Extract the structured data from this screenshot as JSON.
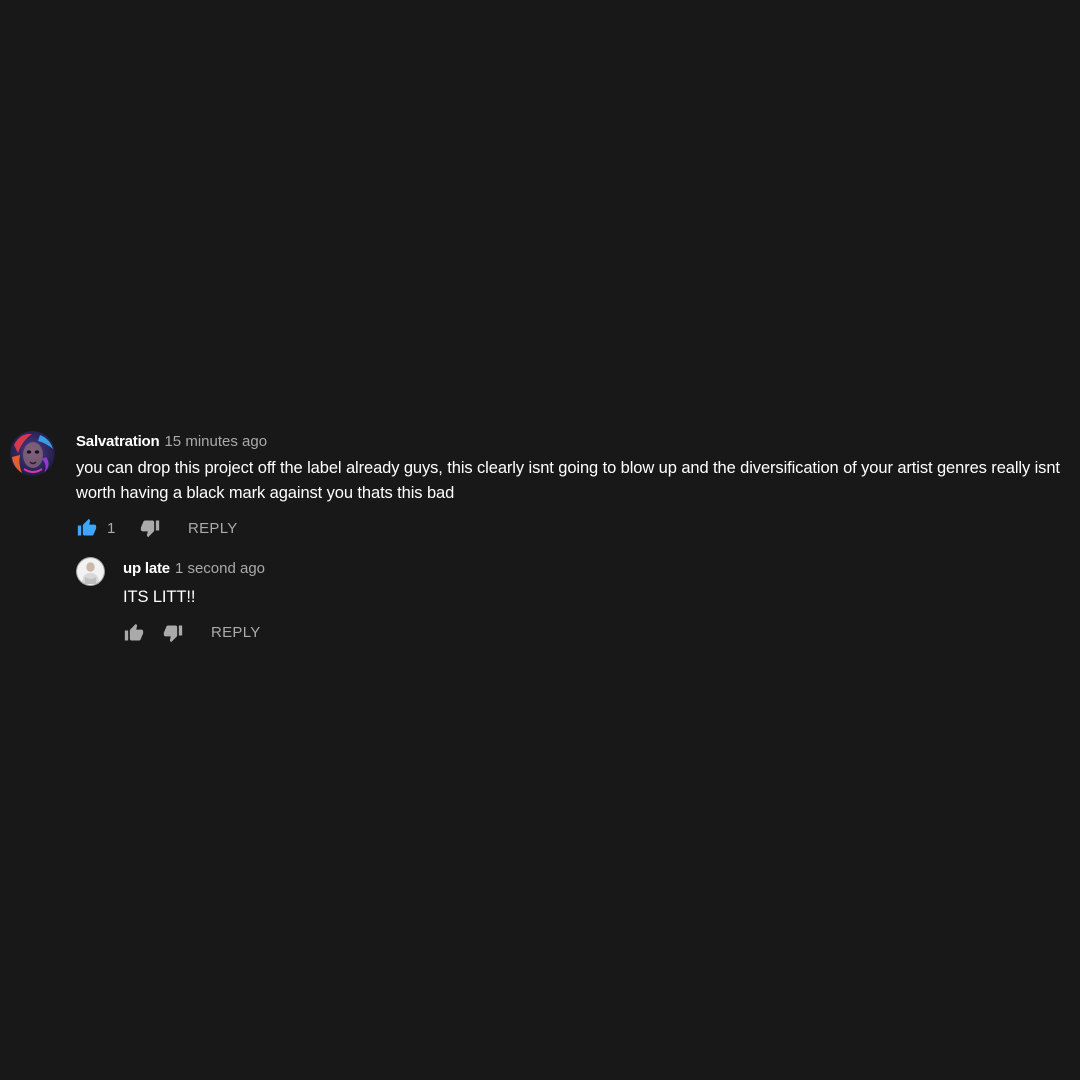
{
  "comment": {
    "author": "Salvatration",
    "time": "15 minutes ago",
    "text": "you can drop this project off the label already guys, this clearly isnt going to blow up and the diversification of your artist genres really isnt worth having a black mark against you thats this bad",
    "like_count": "1",
    "liked": true,
    "reply_label": "REPLY",
    "icons": {
      "like": "thumbs-up-icon",
      "dislike": "thumbs-down-icon"
    },
    "colors": {
      "like_active": "#3ea6ff"
    }
  },
  "reply": {
    "author": "up late",
    "time": "1 second ago",
    "text": "ITS LITT!!",
    "reply_label": "REPLY",
    "icons": {
      "like": "thumbs-up-icon",
      "dislike": "thumbs-down-icon"
    }
  },
  "colors": {
    "background": "#181818",
    "primary_text": "#ffffff",
    "secondary_text": "#aaaaaa"
  }
}
